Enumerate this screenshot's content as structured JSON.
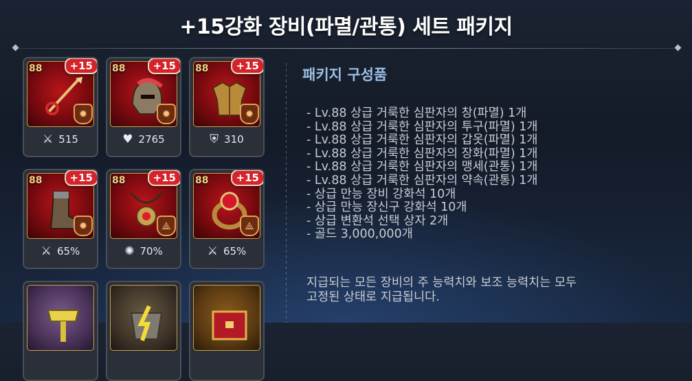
{
  "header": {
    "title": "+15강화 장비(파멸/관통) 세트 패키지"
  },
  "items": [
    {
      "level": "88",
      "enhance": "+15",
      "stat_icon": "sword-icon",
      "stat": "515",
      "emblem": "✹"
    },
    {
      "level": "88",
      "enhance": "+15",
      "stat_icon": "heart-icon",
      "stat": "2765",
      "emblem": "✹"
    },
    {
      "level": "88",
      "enhance": "+15",
      "stat_icon": "shield-icon",
      "stat": "310",
      "emblem": "✹"
    },
    {
      "level": "88",
      "enhance": "+15",
      "stat_icon": "sword-icon",
      "stat": "65%",
      "emblem": "✹"
    },
    {
      "level": "88",
      "enhance": "+15",
      "stat_icon": "burst-icon",
      "stat": "70%",
      "emblem": "⟁"
    },
    {
      "level": "88",
      "enhance": "+15",
      "stat_icon": "sword-icon",
      "stat": "65%",
      "emblem": "⟁"
    }
  ],
  "package": {
    "title": "패키지 구성품",
    "contents": [
      "- Lv.88 상급 거룩한 심판자의 창(파멸) 1개",
      "- Lv.88 상급 거룩한 심판자의 투구(파멸) 1개",
      "- Lv.88 상급 거룩한 심판자의 갑옷(파멸) 1개",
      "- Lv.88 상급 거룩한 심판자의 장화(파멸) 1개",
      "- Lv.88 상급 거룩한 심판자의 맹세(관통) 1개",
      "- Lv.88 상급 거룩한 심판자의 약속(관통) 1개",
      "- 상급 만능 장비 강화석 10개",
      "- 상급 만능 장신구 강화석 10개",
      "- 상급 변환석 선택 상자 2개",
      "- 골드 3,000,000개"
    ],
    "note_line1": "지급되는 모든 장비의 주 능력치와 보조 능력치는 모두",
    "note_line2": "고정된 상태로 지급됩니다."
  }
}
